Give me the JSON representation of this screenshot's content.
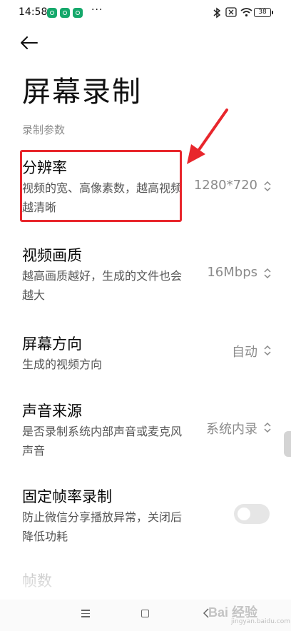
{
  "status_bar": {
    "time": "14:58",
    "dots": "···",
    "battery": "38",
    "notification_icons": [
      "app-notification-icon",
      "app-notification-icon",
      "app-notification-icon"
    ],
    "system_icons": [
      "bluetooth-icon",
      "sim-off-icon",
      "wifi-icon",
      "battery-icon"
    ]
  },
  "header": {
    "back_icon": "back-arrow-icon",
    "title": "屏幕录制"
  },
  "section": {
    "label": "录制参数"
  },
  "settings": [
    {
      "title": "分辨率",
      "desc": "视频的宽、高像素数，越高视频越清晰",
      "value": "1280*720"
    },
    {
      "title": "视频画质",
      "desc": "越高画质越好，生成的文件也会越大",
      "value": "16Mbps"
    },
    {
      "title": "屏幕方向",
      "desc": "生成的视频方向",
      "value": "自动"
    },
    {
      "title": "声音来源",
      "desc": "是否录制系统内部声音或麦克风声音",
      "value": "系统内录"
    },
    {
      "title": "固定帧率录制",
      "desc": "防止微信分享播放异常，关闭后降低功耗",
      "toggle_on": false
    },
    {
      "title": "帧数"
    }
  ],
  "annotation": {
    "highlight_color": "#e8262c"
  },
  "nav_bar": {
    "icons": [
      "menu-icon",
      "home-icon",
      "back-icon"
    ]
  },
  "watermark": {
    "text": "Bai 经验",
    "sub": "jingyan.baidu.com"
  }
}
